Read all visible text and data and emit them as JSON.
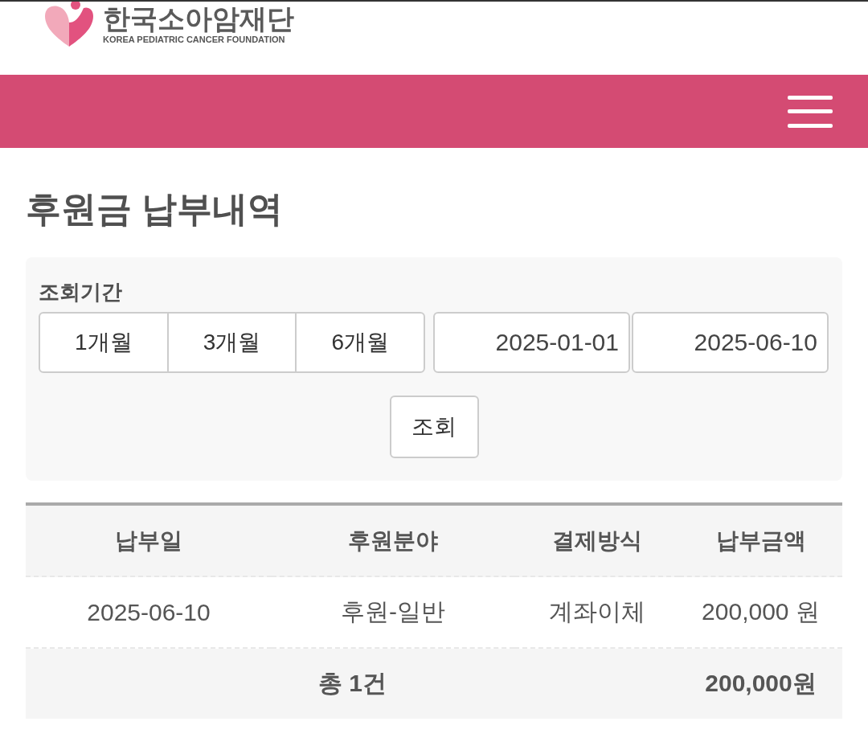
{
  "logo": {
    "name": "한국소아암재단",
    "subtitle": "KOREA PEDIATRIC CANCER FOUNDATION"
  },
  "page_title": "후원금 납부내역",
  "filter": {
    "label": "조회기간",
    "periods": [
      {
        "label": "1개월",
        "selected": false
      },
      {
        "label": "3개월",
        "selected": false
      },
      {
        "label": "6개월",
        "selected": false
      }
    ],
    "start_date": "2025-01-01",
    "end_date": "2025-06-10",
    "search_button": "조회"
  },
  "table": {
    "columns": [
      "납부일",
      "후원분야",
      "결제방식",
      "납부금액"
    ],
    "rows": [
      [
        "2025-06-10",
        "후원-일반",
        "계좌이체",
        "200,000 원"
      ]
    ],
    "total": {
      "count": "총 1건",
      "amount": "200,000원"
    }
  }
}
